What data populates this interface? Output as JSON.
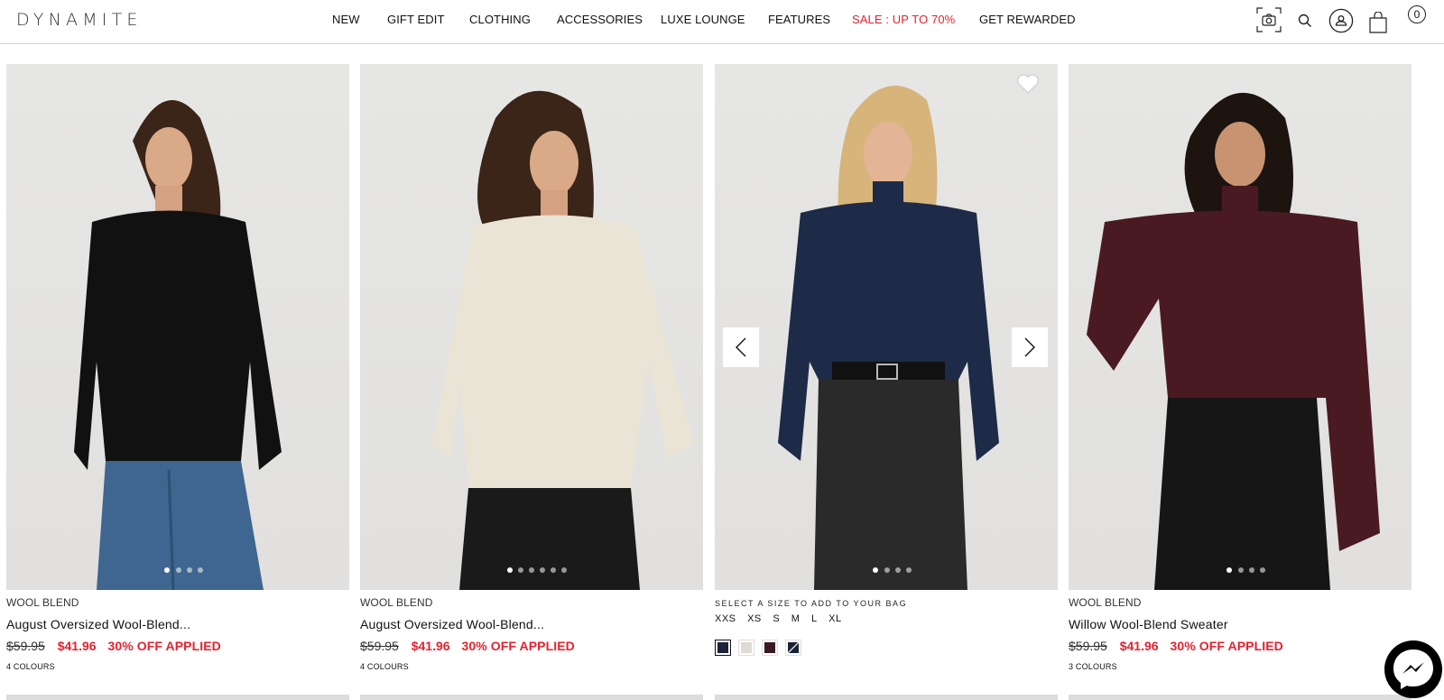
{
  "header": {
    "logo": "DYNAMITE",
    "nav": [
      {
        "label": "NEW",
        "highlight": false
      },
      {
        "label": "GIFT EDIT",
        "highlight": false
      },
      {
        "label": "CLOTHING",
        "highlight": false
      },
      {
        "label": "ACCESSORIES",
        "highlight": false
      },
      {
        "label": "LUXE LOUNGE",
        "highlight": false
      },
      {
        "label": "FEATURES",
        "highlight": false
      },
      {
        "label": "SALE : UP TO 70%",
        "highlight": true
      },
      {
        "label": "GET REWARDED",
        "highlight": false
      }
    ],
    "icons": [
      "camera-search-icon",
      "search-icon",
      "account-icon",
      "shopping-bag-icon"
    ],
    "bag_count": "0",
    "sale_color": "#e8202e"
  },
  "products": [
    {
      "tag": "WOOL BLEND",
      "name": "August Oversized Wool-Blend...",
      "original_price": "$59.95",
      "sale_price": "$41.96",
      "discount": "30% OFF APPLIED",
      "colours": "4 COLOURS",
      "sweater_color": "#111111",
      "image_count": 4,
      "active_image": 1
    },
    {
      "tag": "WOOL BLEND",
      "name": "August Oversized Wool-Blend...",
      "original_price": "$59.95",
      "sale_price": "$41.96",
      "discount": "30% OFF APPLIED",
      "colours": "4 COLOURS",
      "sweater_color": "#e9e4d6",
      "image_count": 6,
      "active_image": 1
    },
    {
      "hover": true,
      "size_prompt": "SELECT A SIZE TO ADD TO YOUR BAG",
      "sizes": [
        "XXS",
        "XS",
        "S",
        "M",
        "L",
        "XL"
      ],
      "swatches": [
        {
          "name": "navy",
          "color": "#1b2438",
          "selected": true
        },
        {
          "name": "cream",
          "color": "#dedbd4",
          "selected": false
        },
        {
          "name": "burgundy",
          "color": "#3a1a20",
          "selected": false
        },
        {
          "name": "black-navy",
          "color": "#1a2333",
          "selected": false
        }
      ],
      "sweater_color": "#1d2a48",
      "image_count": 4,
      "active_image": 1,
      "prev_label": "previous image",
      "next_label": "next image"
    },
    {
      "tag": "WOOL BLEND",
      "name": "Willow Wool-Blend Sweater",
      "original_price": "$59.95",
      "sale_price": "$41.96",
      "discount": "30% OFF APPLIED",
      "colours": "3 COLOURS",
      "sweater_color": "#4a1a22",
      "image_count": 4,
      "active_image": 1
    }
  ],
  "chat": {
    "icon": "messenger-icon"
  }
}
